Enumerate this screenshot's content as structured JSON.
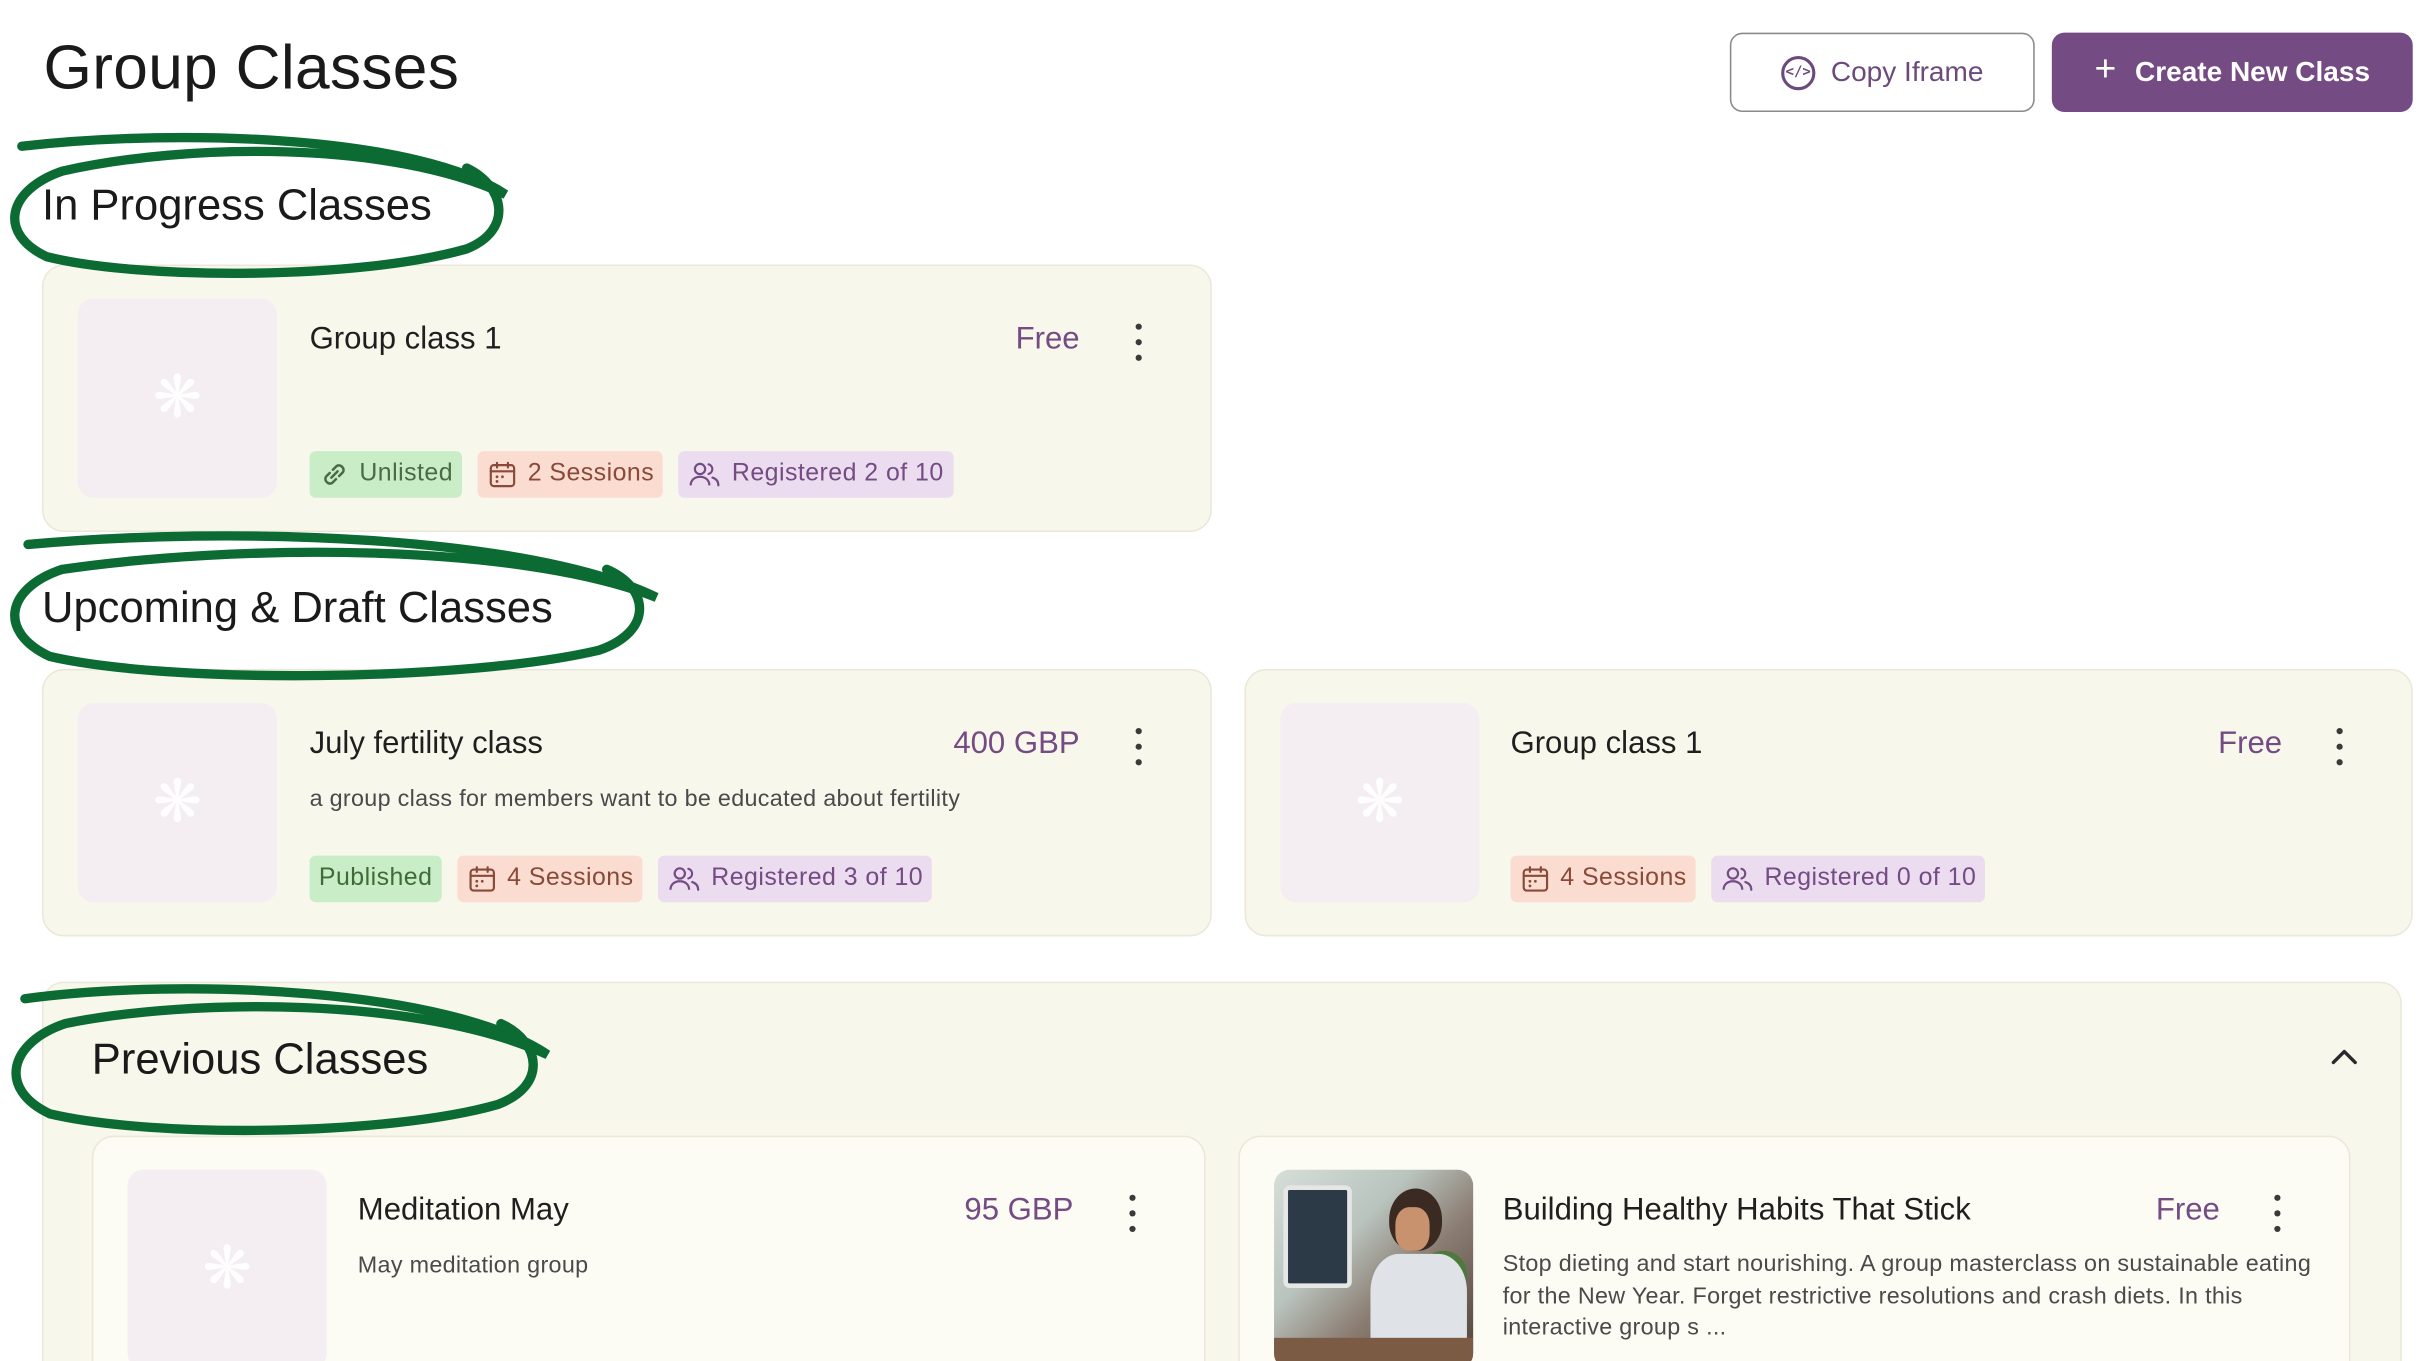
{
  "page": {
    "title": "Group Classes"
  },
  "header": {
    "copy_iframe_label": "Copy Iframe",
    "create_class_label": "Create New Class",
    "copy_iframe_icon": "code-circle-icon",
    "create_icon": "plus-icon"
  },
  "sections": {
    "in_progress": "In Progress Classes",
    "upcoming": "Upcoming & Draft Classes",
    "previous": "Previous Classes"
  },
  "in_progress_cards": [
    {
      "title": "Group class 1",
      "price": "Free",
      "description": "",
      "status": "Unlisted",
      "sessions": "2 Sessions",
      "registered": "Registered 2 of 10"
    }
  ],
  "upcoming_cards": [
    {
      "title": "July fertility class",
      "price": "400 GBP",
      "description": "a group class for members want to be educated about fertility",
      "status": "Published",
      "sessions": "4 Sessions",
      "registered": "Registered 3 of 10"
    },
    {
      "title": "Group class 1",
      "price": "Free",
      "description": "",
      "sessions": "4 Sessions",
      "registered": "Registered 0 of 10"
    }
  ],
  "previous_cards": [
    {
      "title": "Meditation May",
      "price": "95 GBP",
      "description": "May meditation group"
    },
    {
      "title": "Building Healthy Habits That Stick",
      "price": "Free",
      "description": "Stop dieting and start nourishing. A group masterclass on sustainable eating for the New Year. Forget restrictive resolutions and crash diets. In this interactive group s ..."
    }
  ],
  "colors": {
    "accent": "#744b83",
    "card_bg": "#f8f7ec",
    "annotation": "#0b6b32"
  }
}
